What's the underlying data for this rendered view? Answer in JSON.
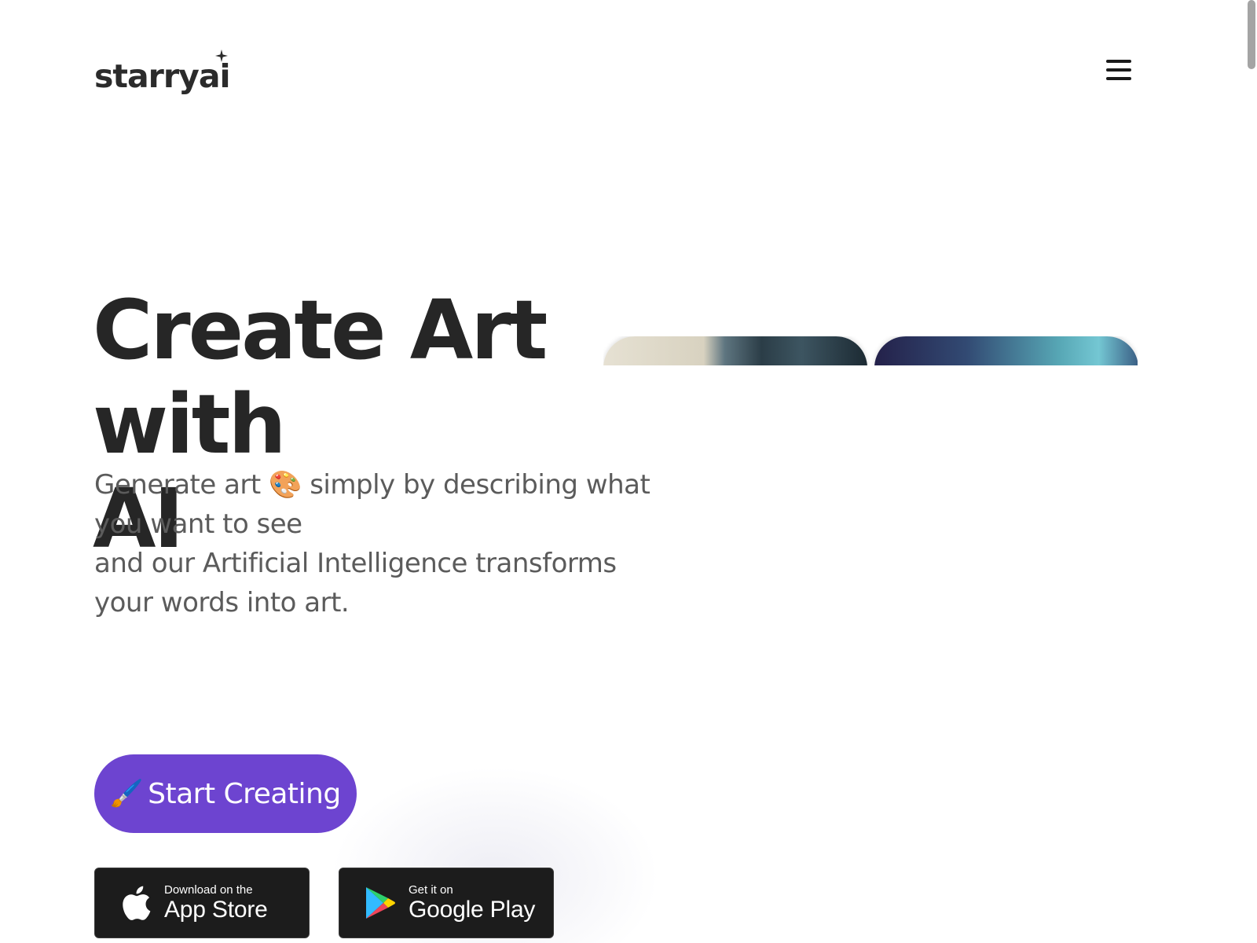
{
  "header": {
    "logo_text": "starryai",
    "menu_label": "menu"
  },
  "hero": {
    "title_line_1": "Create Art with",
    "title_line_2": "AI",
    "subtitle_line_1a": "Generate art",
    "subtitle_emoji": "🎨",
    "subtitle_line_1b": "simply by describing what",
    "subtitle_line_2": "you want to see",
    "subtitle_line_3": "and our Artificial Intelligence transforms",
    "subtitle_line_4": "your words into art."
  },
  "cta": {
    "emoji": "🖌️",
    "label": "Start Creating",
    "color": "#6d44d0"
  },
  "stores": {
    "app_store": {
      "small": "Download on the",
      "big": "App Store",
      "icon": "apple-icon"
    },
    "google_play": {
      "small": "Get it on",
      "big": "Google Play",
      "icon": "google-play-icon"
    }
  },
  "colors": {
    "text_dark": "#262626",
    "text_muted": "#5b5b5b",
    "store_bg": "#1c1c1c"
  }
}
